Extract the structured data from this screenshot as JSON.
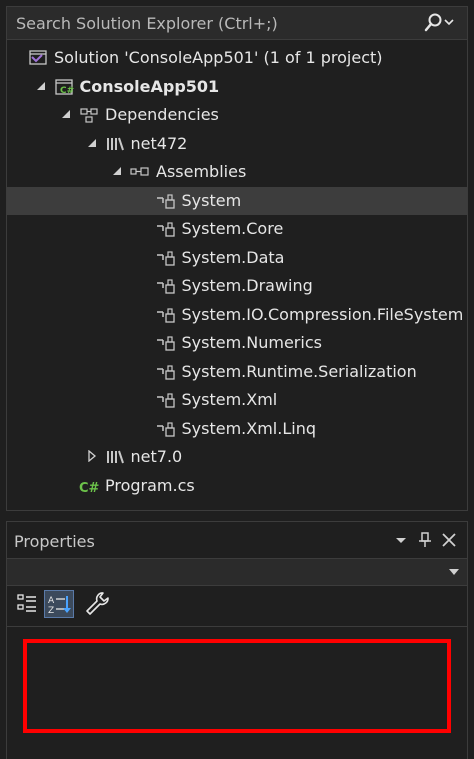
{
  "solution_explorer": {
    "search_placeholder": "Search Solution Explorer (Ctrl+;)",
    "tree": [
      {
        "label": "Solution 'ConsoleApp501' (1 of 1 project)",
        "icon": "solution-icon",
        "level": 0,
        "expanded": null,
        "bold": false,
        "selected": false
      },
      {
        "label": "ConsoleApp501",
        "icon": "csharp-project-icon",
        "level": 1,
        "expanded": true,
        "bold": true,
        "selected": false
      },
      {
        "label": "Dependencies",
        "icon": "dependencies-icon",
        "level": 2,
        "expanded": true,
        "bold": false,
        "selected": false
      },
      {
        "label": "net472",
        "icon": "framework-icon",
        "level": 3,
        "expanded": true,
        "bold": false,
        "selected": false
      },
      {
        "label": "Assemblies",
        "icon": "assemblies-icon",
        "level": 4,
        "expanded": true,
        "bold": false,
        "selected": false
      },
      {
        "label": "System",
        "icon": "reference-icon",
        "level": 5,
        "expanded": null,
        "bold": false,
        "selected": true
      },
      {
        "label": "System.Core",
        "icon": "reference-icon",
        "level": 5,
        "expanded": null,
        "bold": false,
        "selected": false
      },
      {
        "label": "System.Data",
        "icon": "reference-icon",
        "level": 5,
        "expanded": null,
        "bold": false,
        "selected": false
      },
      {
        "label": "System.Drawing",
        "icon": "reference-icon",
        "level": 5,
        "expanded": null,
        "bold": false,
        "selected": false
      },
      {
        "label": "System.IO.Compression.FileSystem",
        "icon": "reference-icon",
        "level": 5,
        "expanded": null,
        "bold": false,
        "selected": false
      },
      {
        "label": "System.Numerics",
        "icon": "reference-icon",
        "level": 5,
        "expanded": null,
        "bold": false,
        "selected": false
      },
      {
        "label": "System.Runtime.Serialization",
        "icon": "reference-icon",
        "level": 5,
        "expanded": null,
        "bold": false,
        "selected": false
      },
      {
        "label": "System.Xml",
        "icon": "reference-icon",
        "level": 5,
        "expanded": null,
        "bold": false,
        "selected": false
      },
      {
        "label": "System.Xml.Linq",
        "icon": "reference-icon",
        "level": 5,
        "expanded": null,
        "bold": false,
        "selected": false
      },
      {
        "label": "net7.0",
        "icon": "framework-icon",
        "level": 3,
        "expanded": false,
        "bold": false,
        "selected": false
      },
      {
        "label": "Program.cs",
        "icon": "csharp-file-icon",
        "level": 2,
        "expanded": null,
        "bold": false,
        "selected": false
      }
    ]
  },
  "properties": {
    "title": "Properties",
    "combo_value": "",
    "toolbar": [
      {
        "name": "categorized-button",
        "icon": "categorized-icon",
        "active": false
      },
      {
        "name": "alphabetical-button",
        "icon": "alphabetical-icon",
        "active": true
      },
      {
        "name": "property-pages-button",
        "icon": "wrench-icon",
        "active": false
      }
    ]
  },
  "colors": {
    "background": "#1f1f1f",
    "selection": "#3d3d3d",
    "highlight_border": "#ff0000",
    "csharp_green": "#6cc24a",
    "solution_purple": "#a073d8"
  }
}
